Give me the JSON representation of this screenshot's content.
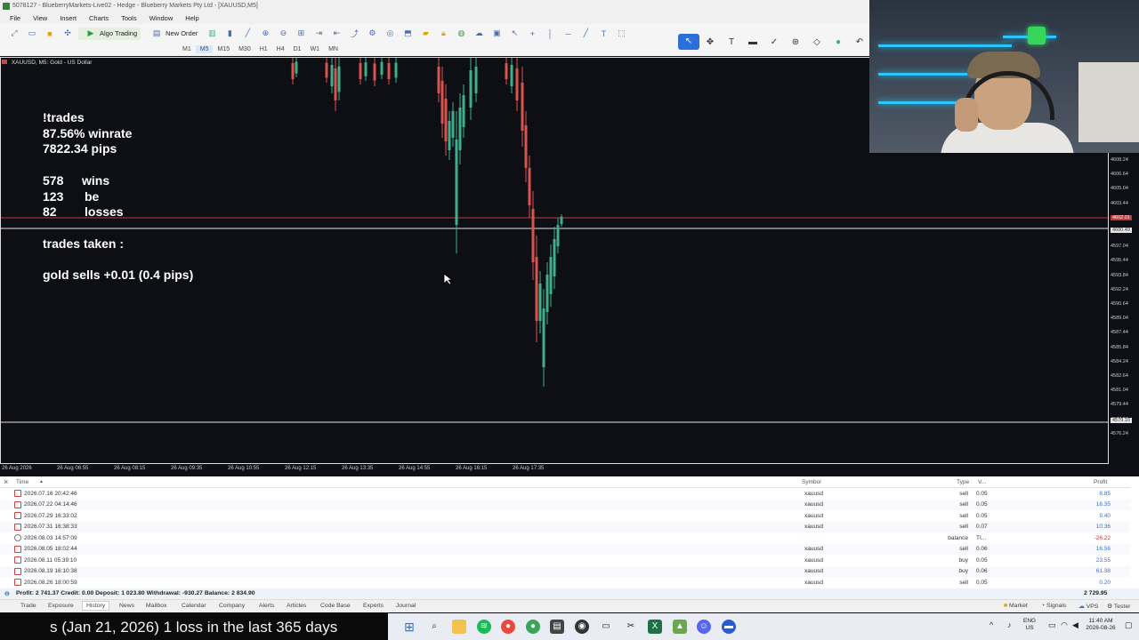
{
  "window": {
    "title": "5078127 - BlueberryMarkets-Live02 - Hedge - Blueberry Markets Pty Ltd - [XAUUSD,M5]"
  },
  "menu": [
    "File",
    "View",
    "Insert",
    "Charts",
    "Tools",
    "Window",
    "Help"
  ],
  "toolbar": {
    "algo_label": "Algo Trading",
    "new_order_label": "New Order"
  },
  "timeframes": [
    "M1",
    "M5",
    "M15",
    "M30",
    "H1",
    "H4",
    "D1",
    "W1",
    "MN"
  ],
  "chart": {
    "tab_label": "XAUUSD, M5: Gold - US Dollar",
    "price_labels": [
      "4608.24",
      "4606.64",
      "4605.04",
      "4603.44",
      "4600.24",
      "4598.64",
      "4597.04",
      "4595.44",
      "4593.84",
      "4592.24",
      "4590.64",
      "4589.04",
      "4587.44",
      "4585.84",
      "4584.24",
      "4582.64",
      "4581.04",
      "4579.44",
      "4577.84",
      "4576.24"
    ],
    "price_highlight_bid": "4602.01",
    "price_highlight_ask": "4600.49",
    "price_highlight_low": "4579.10",
    "time_labels": [
      "26 Aug 2026",
      "26 Aug 06:55",
      "26 Aug 08:15",
      "26 Aug 09:35",
      "26 Aug 10:55",
      "26 Aug 12:15",
      "26 Aug 13:35",
      "26 Aug 14:55",
      "26 Aug 16:15",
      "26 Aug 17:35"
    ]
  },
  "overlay": {
    "command": "!trades",
    "winrate": "87.56% winrate",
    "pips": "7822.34 pips",
    "wins_n": "578",
    "wins_label": "wins",
    "be_n": "123",
    "be_label": "be",
    "losses_n": "82",
    "losses_label": "losses",
    "trades_taken": "trades taken :",
    "trade_line": "gold sells +0.01 (0.4 pips)"
  },
  "history": {
    "headers": {
      "time": "Time",
      "symbol": "Symbol",
      "type": "Type",
      "volume": "V...",
      "profit": "Profit"
    },
    "rows": [
      {
        "time": "2026.07.16 20:42:46",
        "symbol": "xauusd",
        "type": "sell",
        "volume": "0.05",
        "profit": "8.85"
      },
      {
        "time": "2026.07.22 04:14:46",
        "symbol": "xauusd",
        "type": "sell",
        "volume": "0.05",
        "profit": "16.35"
      },
      {
        "time": "2026.07.29 16:33:02",
        "symbol": "xauusd",
        "type": "sell",
        "volume": "0.05",
        "profit": "9.40"
      },
      {
        "time": "2026.07.31 16:38:33",
        "symbol": "xauusd",
        "type": "sell",
        "volume": "0.07",
        "profit": "10.36"
      },
      {
        "time": "2026.08.03 14:57:09",
        "symbol": "",
        "type": "balance",
        "volume": "TI...",
        "profit": "-26.22"
      },
      {
        "time": "2026.08.05 18:02:44",
        "symbol": "xauusd",
        "type": "sell",
        "volume": "0.06",
        "profit": "16.56"
      },
      {
        "time": "2026.08.11 05:39:10",
        "symbol": "xauusd",
        "type": "buy",
        "volume": "0.05",
        "profit": "23.55"
      },
      {
        "time": "2026.08.19 16:10:38",
        "symbol": "xauusd",
        "type": "buy",
        "volume": "0.06",
        "profit": "61.38"
      },
      {
        "time": "2026.08.26 18:00:59",
        "symbol": "xauusd",
        "type": "sell",
        "volume": "0.05",
        "profit": "0.20"
      }
    ],
    "summary": "Profit: 2 741.37  Credit: 0.00  Deposit: 1 023.80  Withdrawal: -930.27  Balance: 2 834.90",
    "summary_total": "2 729.95"
  },
  "tabs": [
    "Trade",
    "Exposure",
    "History",
    "News",
    "Mailbox",
    "Calendar",
    "Company",
    "Alerts",
    "Articles",
    "Code Base",
    "Experts",
    "Journal"
  ],
  "status_right": {
    "market": "Market",
    "signals": "Signals",
    "vps": "VPS",
    "tester": "Tester"
  },
  "taskbar": {
    "ticker": "s (Jan 21, 2026) 1 loss in the last 365 days",
    "lang": "ENG",
    "region": "US",
    "clock_time": "11:40 AM",
    "clock_date": "2026-08-26"
  },
  "colors": {
    "bear": "#d9534f",
    "bull": "#3fae8a",
    "accent": "#2a6fdb"
  }
}
